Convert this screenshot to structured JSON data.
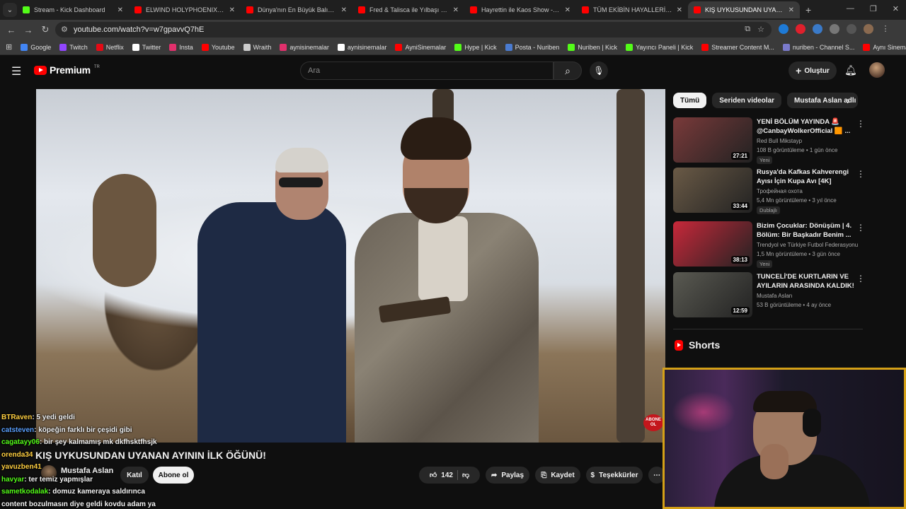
{
  "browser": {
    "tabs": [
      {
        "title": "Stream - Kick Dashboard",
        "color": "#53fc18"
      },
      {
        "title": "ELWIND HOLYPHOENIX'E TEK A",
        "color": "#ff0000"
      },
      {
        "title": "Dünya'nın En Büyük Balığı: Balı",
        "color": "#ff0000"
      },
      {
        "title": "Fred & Talisca ile Yılbaşı Kurabi",
        "color": "#ff0000"
      },
      {
        "title": "Hayrettin ile Kaos Show - 2.Sez",
        "color": "#ff0000"
      },
      {
        "title": "TÜM EKİBİN HAYALLERİNİ GER",
        "color": "#ff0000"
      },
      {
        "title": "KIŞ UYKUSUNDAN UYANAN",
        "color": "#ff0000",
        "active": true
      }
    ],
    "url": "youtube.com/watch?v=w7gpavvQ7hE",
    "bookmarks": [
      {
        "label": "Google",
        "color": "#4285f4"
      },
      {
        "label": "Twitch",
        "color": "#9146ff"
      },
      {
        "label": "Netflix",
        "color": "#e50914"
      },
      {
        "label": "Twitter",
        "color": "#ffffff"
      },
      {
        "label": "Insta",
        "color": "#e1306c"
      },
      {
        "label": "Youtube",
        "color": "#ff0000"
      },
      {
        "label": "Wraith",
        "color": "#cccccc"
      },
      {
        "label": "aynisinemalar",
        "color": "#e1306c"
      },
      {
        "label": "aynisinemalar",
        "color": "#ffffff"
      },
      {
        "label": "AyniSinemalar",
        "color": "#ff0000"
      },
      {
        "label": "Hype | Kick",
        "color": "#53fc18"
      },
      {
        "label": "Posta - Nuriben",
        "color": "#4a7bd0"
      },
      {
        "label": "Nuriben | Kick",
        "color": "#53fc18"
      },
      {
        "label": "Yayıncı Paneli | Kick",
        "color": "#53fc18"
      },
      {
        "label": "Streamer Content M...",
        "color": "#ff0000"
      },
      {
        "label": "nuriben - Channel S...",
        "color": "#7a7acc"
      },
      {
        "label": "Aynı Sinemalar - Ça...",
        "color": "#ff0000"
      }
    ]
  },
  "youtube": {
    "brand": "Premium",
    "brand_tr": "TR",
    "search_placeholder": "Ara",
    "create_label": "Oluştur",
    "video": {
      "title": "KIŞ UYKUSUNDAN UYANAN AYININ İLK ÖĞÜNÜ!",
      "channel": "Mustafa Aslan",
      "join_label": "Katıl",
      "subscribe_label": "Abone ol",
      "likes": "142",
      "share_label": "Paylaş",
      "save_label": "Kaydet",
      "thanks_label": "Teşekkürler",
      "overlay_badge": "ABONE OL"
    },
    "chips": [
      "Tümü",
      "Seriden videolar",
      "Mustafa Aslan adlı yü"
    ],
    "recommendations": [
      {
        "title": "YENİ BÖLÜM YAYINDA 🚨 @CanbayWolkerOfficial 🟧 ...",
        "channel": "Red Bull Mikstayp",
        "meta": "108 B görüntüleme • 1 gün önce",
        "badge": "Yeni",
        "duration": "27:21",
        "thumb": "#7a3a3a"
      },
      {
        "title": "Rusya'da Kafkas Kahverengi Ayısı İçin Kupa Avı [4K]",
        "channel": "Трофейная охота",
        "meta": "5,4 Mn görüntüleme • 3 yıl önce",
        "badge": "Dublajlı",
        "duration": "33:44",
        "thumb": "#6a5a46"
      },
      {
        "title": "Bizim Çocuklar: Dönüşüm | 4. Bölüm: Bir Başkadır Benim ...",
        "channel": "Trendyol ve Türkiye Futbol Federasyonu",
        "meta": "1,5 Mn görüntüleme • 3 gün önce",
        "badge": "Yeni",
        "duration": "38:13",
        "thumb": "#c8283a"
      },
      {
        "title": "TUNCELİ'DE KURTLARIN VE AYILARIN ARASINDA KALDIK! ...",
        "channel": "Mustafa Aslan",
        "meta": "53 B görüntüleme • 4 ay önce",
        "badge": "",
        "duration": "12:59",
        "thumb": "#5a5a52"
      }
    ],
    "shorts_label": "Shorts"
  },
  "chat": [
    {
      "user": "BTRaven",
      "color": "#ffcf40",
      "msg": ": 5 yedi geldi"
    },
    {
      "user": "catsteven",
      "color": "#5aa0ff",
      "msg": ": köpeğin farklı bir çeşidi gibi"
    },
    {
      "user": "cagatayy06",
      "color": "#53fc18",
      "msg": ": bir şey kalmamış mk dkfhsktfhsjk"
    },
    {
      "user": "orenda34",
      "color": "#ffcf40",
      "msg": ""
    },
    {
      "user": "yavuzben41",
      "color": "#ffcf40",
      "msg": ""
    },
    {
      "user": "havyar",
      "color": "#53fc18",
      "msg": ": ter temiz yapmışlar"
    },
    {
      "user": "sametkodalak",
      "color": "#53fc18",
      "msg": ": domuz kameraya saldırınca"
    },
    {
      "user": "",
      "color": "#ffffff",
      "msg": "content bozulmasın diye geldi kovdu adam ya"
    }
  ]
}
